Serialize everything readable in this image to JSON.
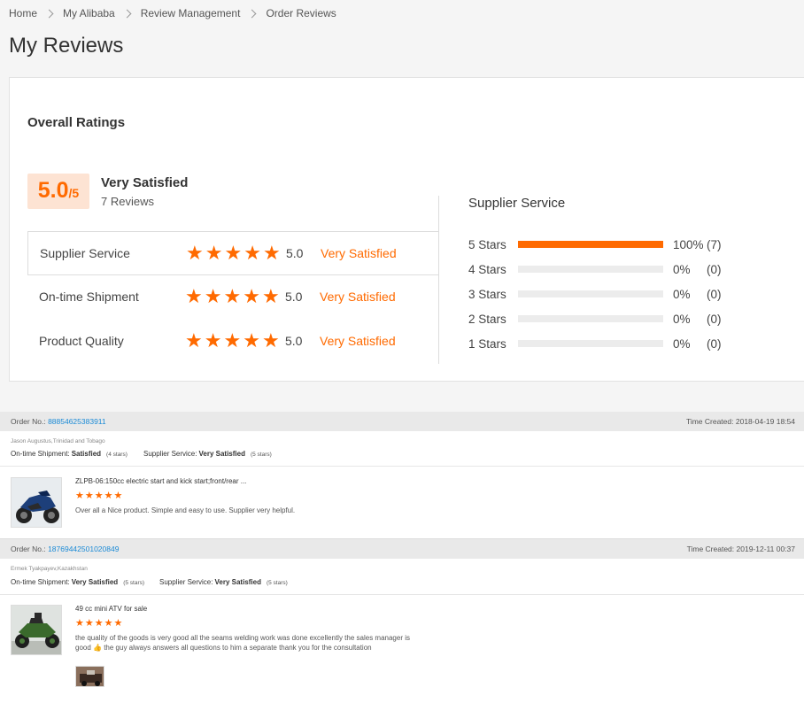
{
  "breadcrumb": [
    "Home",
    "My Alibaba",
    "Review Management",
    "Order Reviews"
  ],
  "page_title": "My Reviews",
  "overall": {
    "title": "Overall Ratings",
    "score": "5.0",
    "score_suffix": "/5",
    "status": "Very Satisfied",
    "reviews": "7 Reviews",
    "rows": [
      {
        "label": "Supplier Service",
        "stars": 5,
        "score": "5.0",
        "status": "Very Satisfied"
      },
      {
        "label": "On-time Shipment",
        "stars": 5,
        "score": "5.0",
        "status": "Very Satisfied"
      },
      {
        "label": "Product Quality",
        "stars": 5,
        "score": "5.0",
        "status": "Very Satisfied"
      }
    ]
  },
  "distribution": {
    "title": "Supplier Service",
    "rows": [
      {
        "label": "5  Stars",
        "fraction": 1.0,
        "pct": "100%",
        "count": "(7)"
      },
      {
        "label": "4  Stars",
        "fraction": 0.0,
        "pct": "0%",
        "count": "(0)"
      },
      {
        "label": "3  Stars",
        "fraction": 0.0,
        "pct": "0%",
        "count": "(0)"
      },
      {
        "label": "2  Stars",
        "fraction": 0.0,
        "pct": "0%",
        "count": "(0)"
      },
      {
        "label": "1  Stars",
        "fraction": 0.0,
        "pct": "0%",
        "count": "(0)"
      }
    ]
  },
  "orders": [
    {
      "order_label": "Order No.:",
      "order_no": "88854625383911",
      "time_label": "Time Created:",
      "time": "2018-04-19 18:54",
      "buyer": "Jason Augustus,Trinidad and Tobago",
      "shipment_label": "On-time Shipment:",
      "shipment_value": "Satisfied",
      "shipment_stars": "(4 stars)",
      "service_label": "Supplier Service:",
      "service_value": "Very Satisfied",
      "service_stars": "(5 stars)",
      "product": "ZLPB-06:150cc electric start and kick start;front/rear ...",
      "stars": 5,
      "comment": "Over all a Nice product. Simple and easy to use. Supplier very helpful."
    },
    {
      "order_label": "Order No.:",
      "order_no": "18769442501020849",
      "time_label": "Time Created:",
      "time": "2019-12-11 00:37",
      "buyer": "Ermek Tyakpayev,Kazakhstan",
      "shipment_label": "On-time Shipment:",
      "shipment_value": "Very Satisfied",
      "shipment_stars": "(5 stars)",
      "service_label": "Supplier Service:",
      "service_value": "Very Satisfied",
      "service_stars": "(5 stars)",
      "product": "49 cc mini ATV for sale",
      "stars": 5,
      "comment": "the quality of the goods is very good all the seams welding work was done excellently the sales manager is good 👍 the guy always answers all questions to him a separate thank you for the consultation"
    }
  ],
  "colors": {
    "accent": "#ff6a00",
    "link": "#1a8ad6",
    "score_bg": "#fde3d3"
  }
}
